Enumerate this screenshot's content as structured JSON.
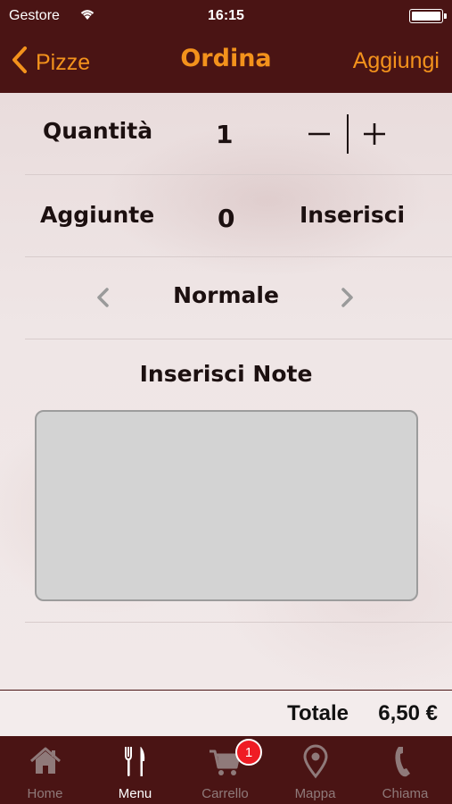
{
  "status_bar": {
    "carrier": "Gestore",
    "time": "16:15"
  },
  "nav": {
    "back_label": "Pizze",
    "title": "Ordina",
    "action_label": "Aggiungi"
  },
  "order": {
    "quantity_label": "Quantità",
    "quantity_value": "1",
    "additions_label": "Aggiunte",
    "additions_value": "0",
    "additions_action": "Inserisci",
    "size_option": "Normale",
    "notes_title": "Inserisci Note",
    "notes_value": ""
  },
  "total": {
    "label": "Totale",
    "value": "6,50 €"
  },
  "tabs": [
    {
      "label": "Home",
      "icon": "home-icon",
      "active": false
    },
    {
      "label": "Menu",
      "icon": "fork-knife-icon",
      "active": true
    },
    {
      "label": "Carrello",
      "icon": "cart-icon",
      "active": false,
      "badge": "1"
    },
    {
      "label": "Mappa",
      "icon": "map-pin-icon",
      "active": false
    },
    {
      "label": "Chiama",
      "icon": "phone-icon",
      "active": false
    }
  ],
  "colors": {
    "bar_background": "#4a1414",
    "accent": "#f3921c",
    "badge": "#ef1c24"
  }
}
